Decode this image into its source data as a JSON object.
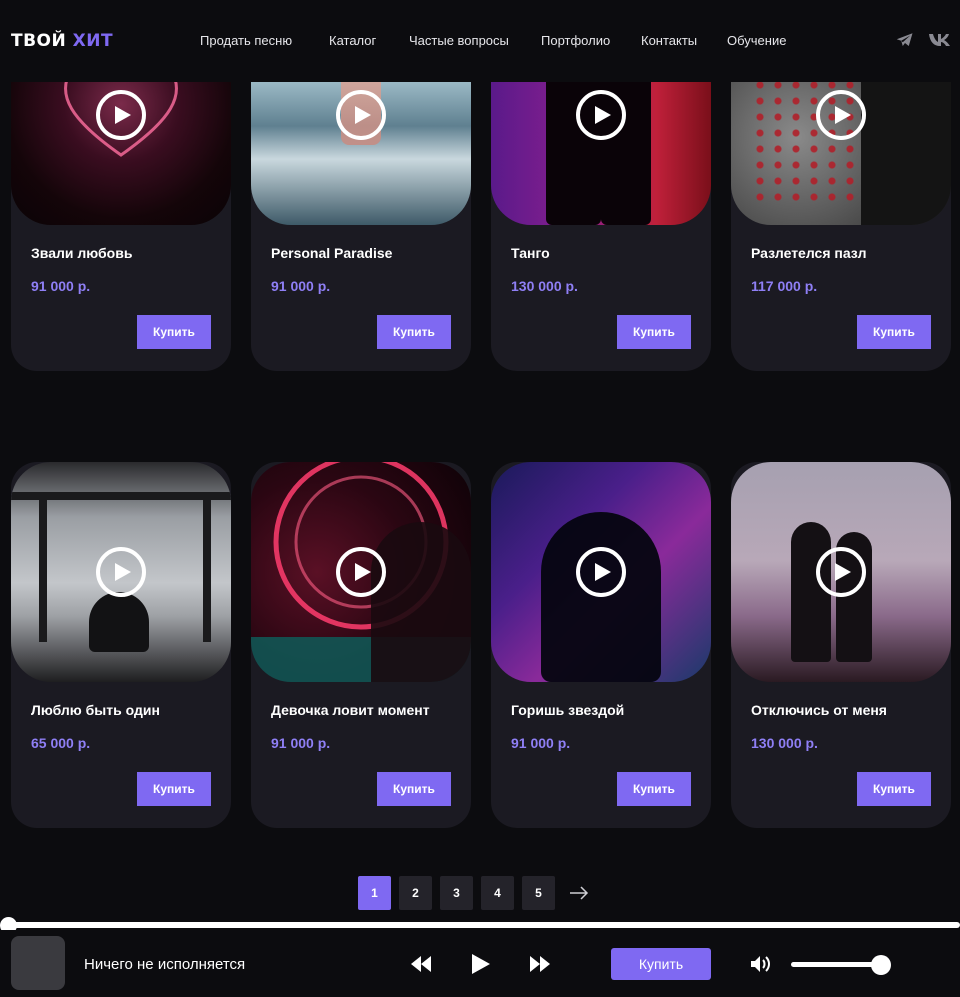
{
  "header": {
    "logo_word1": "ТВОЙ",
    "logo_word2": "ХИТ",
    "nav": [
      "Продать песню",
      "Каталог",
      "Частые вопросы",
      "Портфолио",
      "Контакты",
      "Обучение"
    ],
    "social_icons": [
      "telegram-icon",
      "vk-icon"
    ]
  },
  "colors": {
    "accent": "#7f69f2",
    "price": "#8f7ff5",
    "card_bg": "#1b1a22",
    "page_bg": "#0c0c0f"
  },
  "cards": [
    {
      "title": "Звали любовь",
      "price": "91 000 р.",
      "buy_label": "Купить"
    },
    {
      "title": "Personal Paradise",
      "price": "91 000 р.",
      "buy_label": "Купить"
    },
    {
      "title": "Танго",
      "price": "130 000 р.",
      "buy_label": "Купить"
    },
    {
      "title": "Разлетелся пазл",
      "price": "117 000 р.",
      "buy_label": "Купить"
    },
    {
      "title": "Люблю быть один",
      "price": "65 000 р.",
      "buy_label": "Купить"
    },
    {
      "title": "Девочка ловит момент",
      "price": "91 000 р.",
      "buy_label": "Купить"
    },
    {
      "title": "Горишь звездой",
      "price": "91 000 р.",
      "buy_label": "Купить"
    },
    {
      "title": "Отключись от меня",
      "price": "130 000 р.",
      "buy_label": "Купить"
    }
  ],
  "pagination": {
    "pages": [
      "1",
      "2",
      "3",
      "4",
      "5"
    ],
    "current": "1",
    "next_icon": "arrow-right-icon"
  },
  "player": {
    "now_playing": "Ничего не исполняется",
    "buy_label": "Купить",
    "progress": 0,
    "volume": 0.85
  }
}
